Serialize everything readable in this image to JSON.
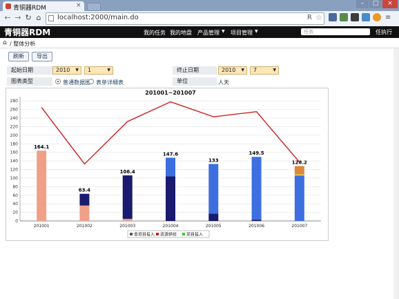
{
  "browser": {
    "tab_title": "青铜器RDM",
    "tab_close": "×",
    "address": "localhost:2000/main.do",
    "address_r": "R",
    "window_controls": [
      "–",
      "□",
      "×"
    ],
    "nav_icons": [
      "back-icon",
      "forward-icon",
      "reload-icon",
      "home-icon"
    ]
  },
  "app": {
    "logo": "青铜器RDM",
    "menu": [
      "我的任务",
      "我的地盘",
      "产品管理",
      "项目管理"
    ],
    "menu_dropdown": [
      false,
      false,
      true,
      true
    ],
    "search_placeholder": "任务",
    "user": "任执行"
  },
  "breadcrumb": {
    "text": "/ 整体分析"
  },
  "actions": {
    "refresh": "刷新",
    "export": "导出"
  },
  "filters": {
    "start_label": "起始日期",
    "start_year": "2010",
    "start_month": "1",
    "end_label": "终止日期",
    "end_year": "2010",
    "end_month": "7",
    "chart_type_label": "图表类型",
    "chart_type_options": [
      "普通数据图",
      "表单详细表"
    ],
    "chart_type_selected": 0,
    "unit_label": "单位",
    "unit_value": "人天"
  },
  "colors": {
    "line": "#cc1e1e",
    "salmon": "#f0a088",
    "navy": "#1a1a6e",
    "royal": "#3d6fe0",
    "orange": "#d98a3a",
    "gold": "#e8c040"
  },
  "chart_data": {
    "type": "bar",
    "title": "201001~201007",
    "categories": [
      "201001",
      "201002",
      "201003",
      "201004",
      "201005",
      "201006",
      "201007"
    ],
    "y_ticks": [
      0,
      20,
      40,
      60,
      80,
      100,
      120,
      140,
      160,
      180,
      200,
      220,
      240,
      260,
      280
    ],
    "ylim": [
      0,
      290
    ],
    "totals": [
      164.1,
      63.4,
      106.4,
      147.6,
      133,
      149.5,
      128.2
    ],
    "segments": [
      [
        {
          "value": 164.1,
          "color": "salmon"
        }
      ],
      [
        {
          "value": 36,
          "color": "salmon"
        },
        {
          "value": 27.4,
          "color": "navy"
        }
      ],
      [
        {
          "value": 5,
          "color": "salmon"
        },
        {
          "value": 101.4,
          "color": "navy"
        }
      ],
      [
        {
          "value": 104,
          "color": "navy"
        },
        {
          "value": 43.6,
          "color": "royal"
        }
      ],
      [
        {
          "value": 17,
          "color": "navy"
        },
        {
          "value": 116,
          "color": "royal"
        }
      ],
      [
        {
          "value": 3,
          "color": "navy"
        },
        {
          "value": 146.5,
          "color": "royal"
        }
      ],
      [
        {
          "value": 106,
          "color": "royal"
        },
        {
          "value": 3,
          "color": "gold"
        },
        {
          "value": 19.2,
          "color": "orange"
        }
      ]
    ],
    "line_values": [
      265,
      133,
      232,
      278,
      243,
      255,
      137
    ],
    "legend": [
      {
        "name": "非项目投入",
        "color": "#555555"
      },
      {
        "name": "资源供给",
        "color": "#cc1e1e"
      },
      {
        "name": "项目投入",
        "color": "#33cc33"
      }
    ],
    "grid": true,
    "legend_position": "bottom"
  }
}
